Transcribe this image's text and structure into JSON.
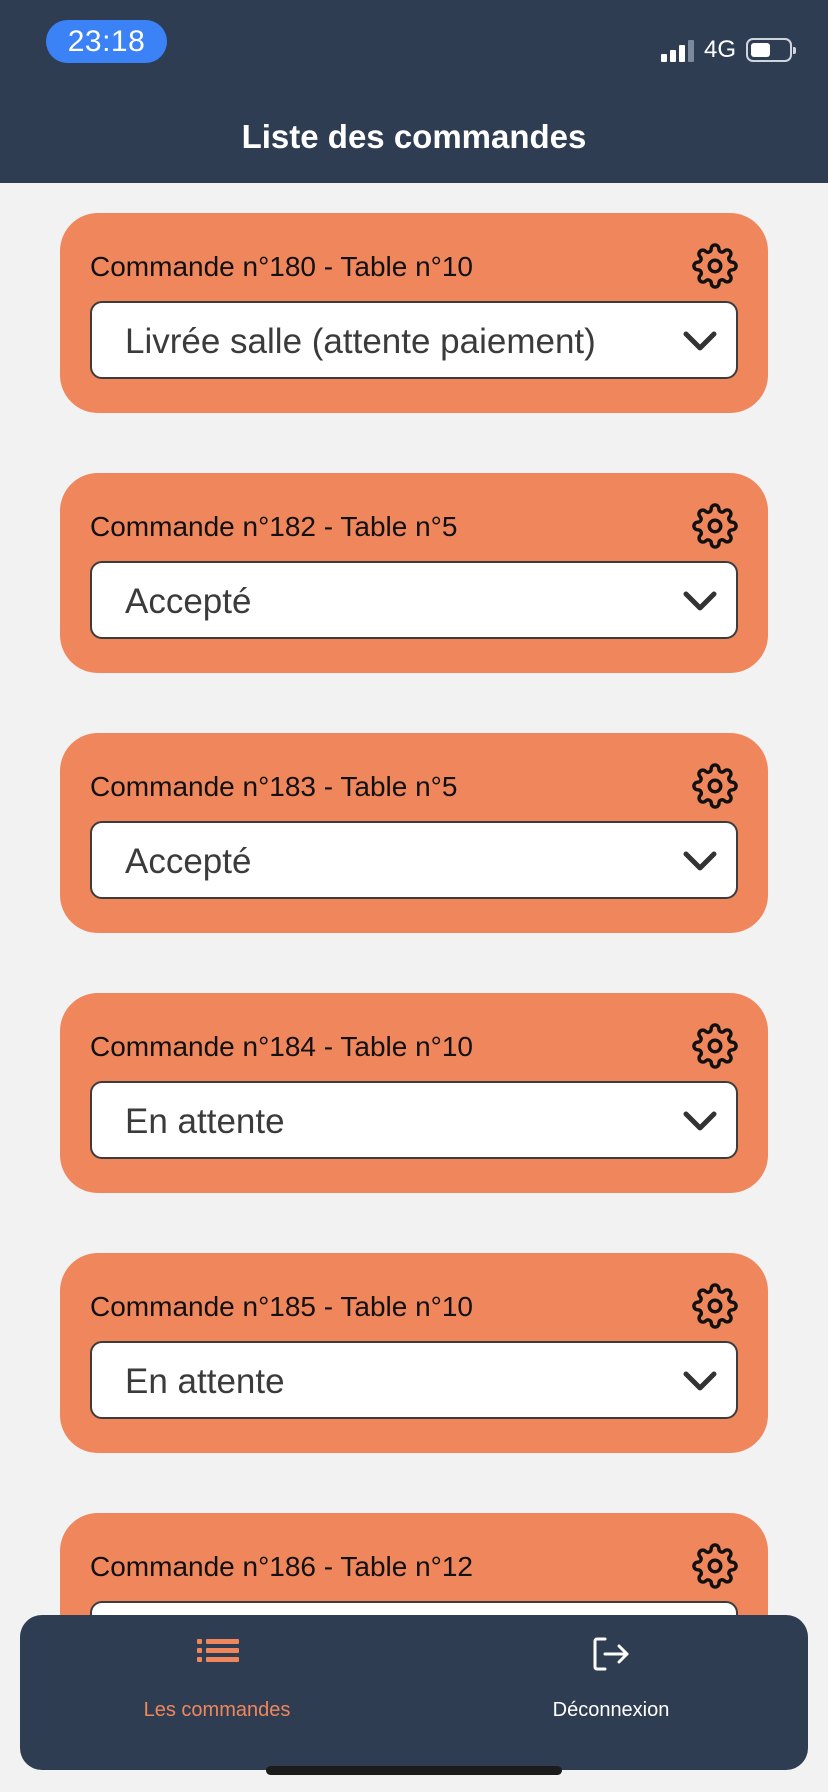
{
  "status_bar": {
    "time": "23:18",
    "network": "4G",
    "battery_level": 0.45
  },
  "header": {
    "title": "Liste des commandes"
  },
  "orders": [
    {
      "label": "Commande n°180 - Table n°10",
      "status": "Livrée salle (attente paiement)"
    },
    {
      "label": "Commande n°182 - Table n°5",
      "status": "Accepté"
    },
    {
      "label": "Commande n°183 - Table n°5",
      "status": "Accepté"
    },
    {
      "label": "Commande n°184 - Table n°10",
      "status": "En attente"
    },
    {
      "label": "Commande n°185 - Table n°10",
      "status": "En attente"
    },
    {
      "label": "Commande n°186 - Table n°12",
      "status": ""
    }
  ],
  "bottom_nav": {
    "items": [
      {
        "label": "Les commandes",
        "icon": "list-icon",
        "active": true
      },
      {
        "label": "Déconnexion",
        "icon": "logout-icon",
        "active": false
      }
    ]
  },
  "colors": {
    "header_bg": "#2f3d53",
    "card_bg": "#ef865c",
    "accent": "#ef865c",
    "time_pill": "#3b82f6",
    "page_bg": "#f2f2f2"
  }
}
